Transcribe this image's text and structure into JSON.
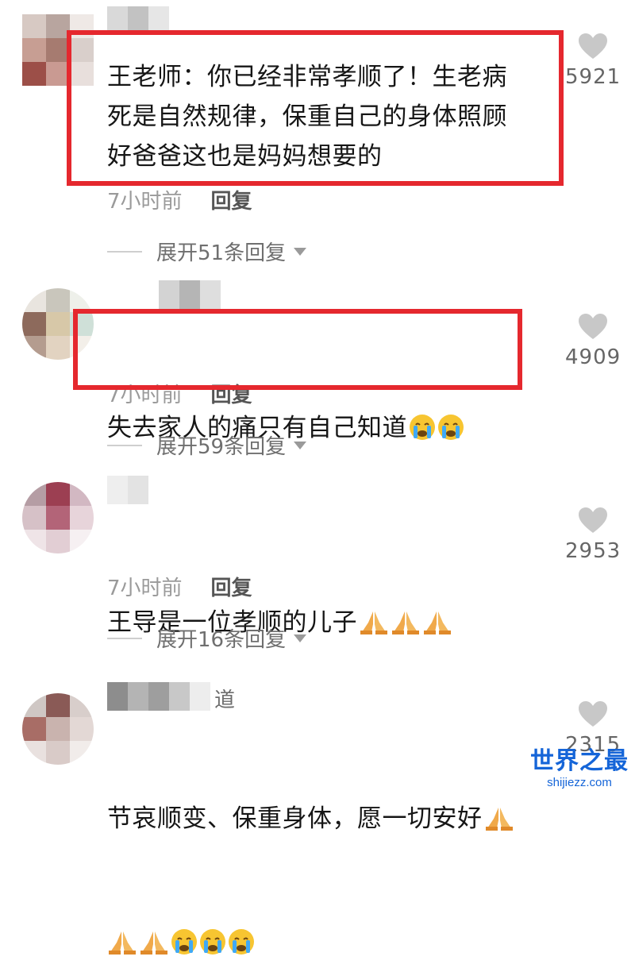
{
  "comments": [
    {
      "text": "王老师：你已经非常孝顺了！生老病\n死是自然规律，保重自己的身体照顾\n好爸爸这也是妈妈想要的",
      "time": "7小时前",
      "reply_label": "回复",
      "expand_label": "展开51条回复",
      "likes": "5921",
      "highlighted": true
    },
    {
      "text": "失去家人的痛只有自己知道",
      "emojis": [
        "crying-face-emoji",
        "crying-face-emoji"
      ],
      "time": "7小时前",
      "reply_label": "回复",
      "expand_label": "展开59条回复",
      "likes": "4909",
      "highlighted": true
    },
    {
      "text": "王导是一位孝顺的儿子",
      "emojis": [
        "folded-hands-emoji",
        "folded-hands-emoji",
        "folded-hands-emoji"
      ],
      "time": "7小时前",
      "reply_label": "回复",
      "expand_label": "展开16条回复",
      "likes": "2953",
      "highlighted": false
    },
    {
      "username_visible": "道",
      "text": "节哀顺变、保重身体，愿一切安好",
      "emojis_line2": [
        "folded-hands-emoji",
        "folded-hands-emoji",
        "crying-face-emoji",
        "crying-face-emoji",
        "crying-face-emoji"
      ],
      "likes": "2315",
      "highlighted": false
    }
  ],
  "watermark": {
    "main": "世界之最",
    "sub": "shijiezz.com"
  },
  "colors": {
    "highlight_border": "#e5282e",
    "like_icon": "#c8c8c8",
    "watermark": "#1565d8"
  }
}
